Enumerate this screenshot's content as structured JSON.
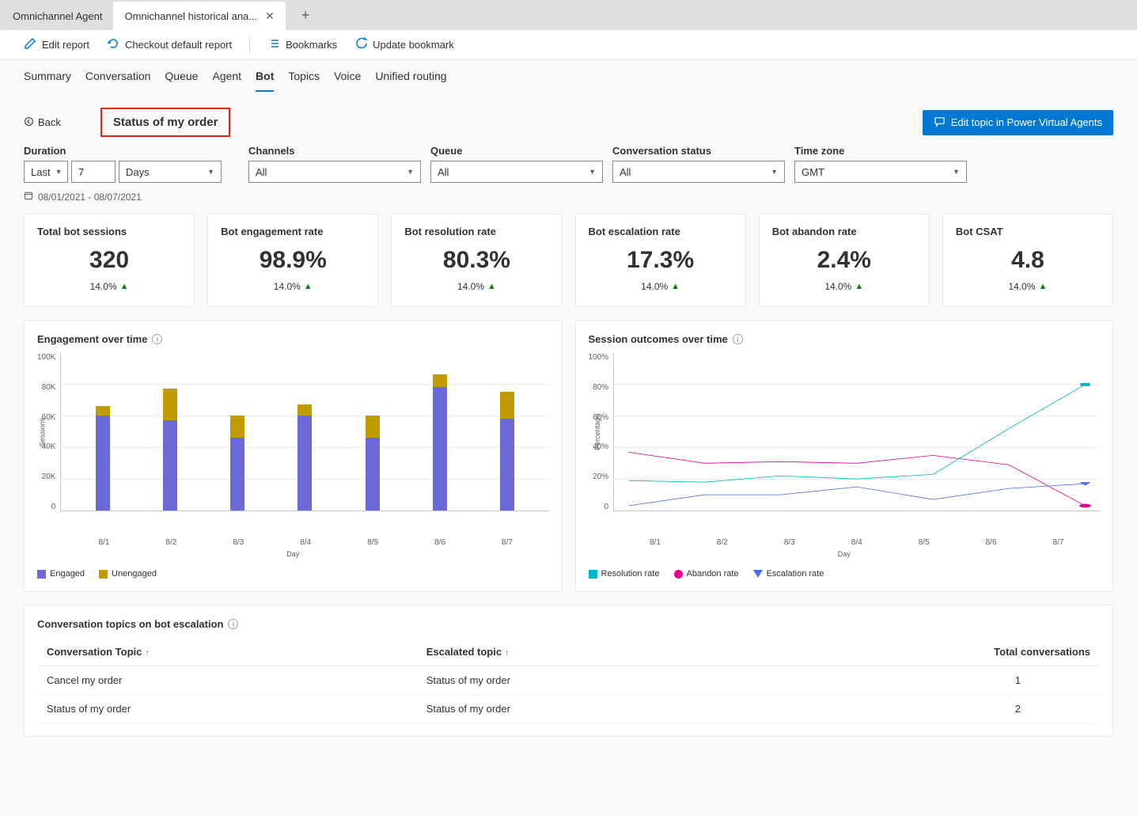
{
  "tabs": {
    "inactive": "Omnichannel Agent",
    "active": "Omnichannel historical ana..."
  },
  "toolbar": {
    "edit": "Edit report",
    "checkout": "Checkout default report",
    "bookmarks": "Bookmarks",
    "update": "Update bookmark"
  },
  "nav": {
    "summary": "Summary",
    "conversation": "Conversation",
    "queue": "Queue",
    "agent": "Agent",
    "bot": "Bot",
    "topics": "Topics",
    "voice": "Voice",
    "unified": "Unified routing"
  },
  "header": {
    "back": "Back",
    "topic": "Status of my order",
    "primary_btn": "Edit topic in Power Virtual Agents"
  },
  "filters": {
    "duration_label": "Duration",
    "duration_last": "Last",
    "duration_num": "7",
    "duration_unit": "Days",
    "channels_label": "Channels",
    "channels_value": "All",
    "queue_label": "Queue",
    "queue_value": "All",
    "status_label": "Conversation status",
    "status_value": "All",
    "tz_label": "Time zone",
    "tz_value": "GMT",
    "date_range": "08/01/2021 - 08/07/2021"
  },
  "kpis": [
    {
      "title": "Total bot sessions",
      "value": "320",
      "trend": "14.0%"
    },
    {
      "title": "Bot engagement rate",
      "value": "98.9%",
      "trend": "14.0%"
    },
    {
      "title": "Bot resolution rate",
      "value": "80.3%",
      "trend": "14.0%"
    },
    {
      "title": "Bot escalation rate",
      "value": "17.3%",
      "trend": "14.0%"
    },
    {
      "title": "Bot abandon rate",
      "value": "2.4%",
      "trend": "14.0%"
    },
    {
      "title": "Bot CSAT",
      "value": "4.8",
      "trend": "14.0%"
    }
  ],
  "chart1": {
    "title": "Engagement over time",
    "ylabel": "Sessions",
    "xlabel": "Day",
    "legend": {
      "a": "Engaged",
      "b": "Unengaged"
    }
  },
  "chart2": {
    "title": "Session outcomes over time",
    "ylabel": "Percentage",
    "xlabel": "Day",
    "legend": {
      "a": "Resolution rate",
      "b": "Abandon rate",
      "c": "Escalation rate"
    }
  },
  "y_ticks_bar": [
    "100K",
    "80K",
    "60K",
    "40K",
    "20K",
    "0"
  ],
  "y_ticks_pct": [
    "100%",
    "80%",
    "60%",
    "40%",
    "20%",
    "0"
  ],
  "x_ticks": [
    "8/1",
    "8/2",
    "8/3",
    "8/4",
    "8/5",
    "8/6",
    "8/7"
  ],
  "table": {
    "title": "Conversation topics on bot escalation",
    "cols": {
      "a": "Conversation Topic",
      "b": "Escalated topic",
      "c": "Total conversations"
    },
    "rows": [
      {
        "a": "Cancel my order",
        "b": "Status of my order",
        "c": "1"
      },
      {
        "a": "Status of my order",
        "b": "Status of my order",
        "c": "2"
      }
    ]
  },
  "chart_data": [
    {
      "type": "bar",
      "title": "Engagement over time",
      "xlabel": "Day",
      "ylabel": "Sessions",
      "ylim": [
        0,
        100000
      ],
      "categories": [
        "8/1",
        "8/2",
        "8/3",
        "8/4",
        "8/5",
        "8/6",
        "8/7"
      ],
      "series": [
        {
          "name": "Engaged",
          "values": [
            60000,
            57000,
            46000,
            60000,
            46000,
            78000,
            58000
          ]
        },
        {
          "name": "Unengaged",
          "values": [
            6000,
            20000,
            14000,
            7000,
            14000,
            8000,
            17000
          ]
        }
      ]
    },
    {
      "type": "line",
      "title": "Session outcomes over time",
      "xlabel": "Day",
      "ylabel": "Percentage",
      "ylim": [
        0,
        100
      ],
      "categories": [
        "8/1",
        "8/2",
        "8/3",
        "8/4",
        "8/5",
        "8/6",
        "8/7"
      ],
      "series": [
        {
          "name": "Resolution rate",
          "values": [
            19,
            18,
            22,
            20,
            23,
            52,
            80
          ]
        },
        {
          "name": "Abandon rate",
          "values": [
            37,
            30,
            31,
            30,
            35,
            29,
            3
          ]
        },
        {
          "name": "Escalation rate",
          "values": [
            3,
            10,
            10,
            15,
            7,
            14,
            17
          ]
        }
      ]
    }
  ]
}
